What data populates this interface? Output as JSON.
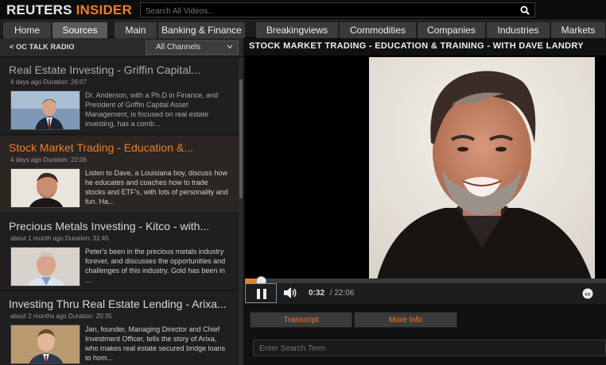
{
  "brand": {
    "part1": "REUTERS",
    "part2": "INSIDER"
  },
  "search": {
    "placeholder": "Search All Videos..."
  },
  "nav": {
    "tabs": [
      "Home",
      "Sources",
      "Main",
      "Banking & Finance",
      "Breakingviews",
      "Commodities",
      "Companies",
      "Industries",
      "Markets"
    ],
    "active": "Sources"
  },
  "sidebar": {
    "back_label": "< OC TALK RADIO",
    "channel_select": "All Channels",
    "items": [
      {
        "title": "Real Estate Investing - Griffin Capital...",
        "meta": "4 days ago   Duration: 26:07",
        "desc": "Dr. Anderson, with a Ph.D in Finance, and President of Griffin Capital Asset Management, is focused on real estate investing, has a comb..."
      },
      {
        "title": "Stock Market Trading - Education &...",
        "meta": "4 days ago   Duration: 22:06",
        "desc": "Listen to Dave, a Louisiana boy, discuss how he educates and coaches how to trade stocks and ETF's, with lots of personality and fun. Ha..."
      },
      {
        "title": "Precious Metals Investing - Kitco - with...",
        "meta": "about 1 month ago   Duration: 31:45",
        "desc": "Peter's been in the precious metals industry forever, and discusses the opportunities and challenges of this industry. Gold has been in ..."
      },
      {
        "title": "Investing Thru Real Estate Lending - Arixa...",
        "meta": "about 2 months ago   Duration: 20:35",
        "desc": "Jan, founder, Managing Director and Chief Investment Officer, tells the story of Arixa, who makes real estate secured bridge loans to hom..."
      }
    ]
  },
  "player": {
    "title": "STOCK MARKET TRADING - EDUCATION & TRAINING - WITH DAVE LANDRY",
    "current_time": "0:32",
    "duration": "/ 22:06",
    "progress": 0.04
  },
  "tabs": {
    "transcript": "Transcript",
    "more_info": "More Info"
  },
  "transcript_search": {
    "placeholder": "Enter Search Term"
  },
  "colors": {
    "accent": "#f07c2a",
    "background": "#111111",
    "panel": "#1f1f1f"
  }
}
